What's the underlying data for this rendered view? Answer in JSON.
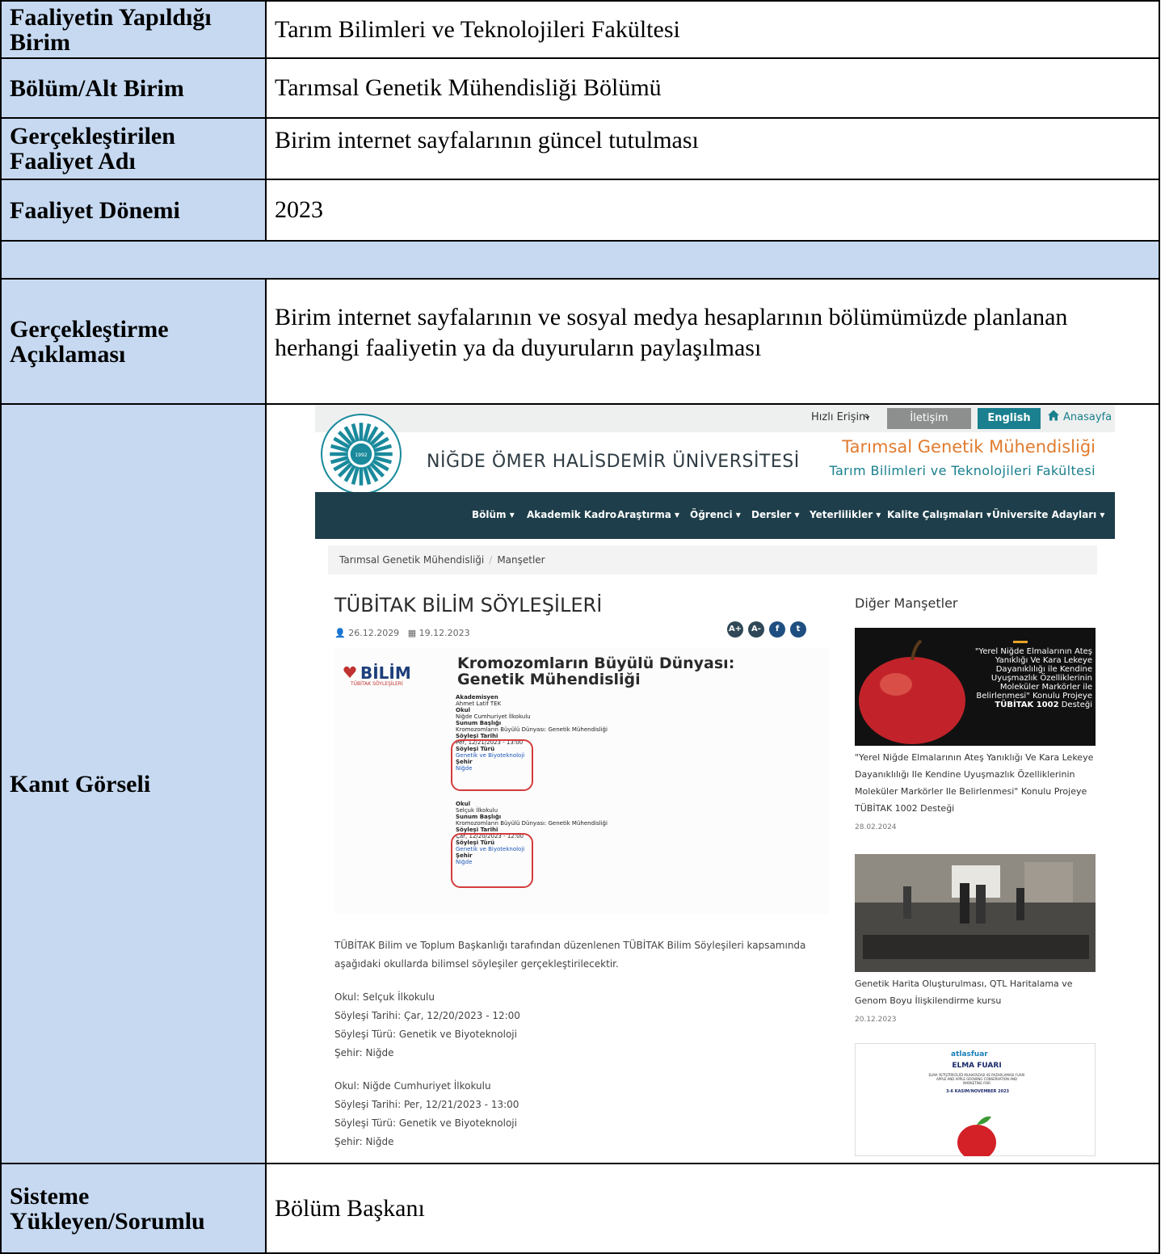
{
  "form": {
    "rows": [
      {
        "label": "Faaliyetin Yapıldığı Birim",
        "value": "Tarım Bilimleri ve Teknolojileri Fakültesi"
      },
      {
        "label": "Bölüm/Alt Birim",
        "value": "Tarımsal Genetik Mühendisliği Bölümü"
      },
      {
        "label": "Gerçekleştirilen Faaliyet Adı",
        "value": "Birim internet sayfalarının güncel tutulması"
      },
      {
        "label": "Faaliyet Dönemi",
        "value": "2023"
      }
    ],
    "description": {
      "label": "Gerçekleştirme Açıklaması",
      "value": "Birim internet sayfalarının ve sosyal medya hesaplarının bölümümüzde planlanan herhangi faaliyetin ya da duyuruların paylaşılması"
    },
    "evidence_label": "Kanıt Görseli",
    "uploader": {
      "label": "Sisteme Yükleyen/Sorumlu",
      "value": "Bölüm Başkanı"
    }
  },
  "site": {
    "topbar": {
      "quick_access": "Hızlı Erişim",
      "contact": "İletişim",
      "english": "English",
      "home": "Anasayfa"
    },
    "logo_year": "1992",
    "university": "NİĞDE ÖMER HALİSDEMİR ÜNİVERSİTESİ",
    "department": "Tarımsal Genetik Mühendisliği",
    "faculty": "Tarım Bilimleri ve Teknolojileri Fakültesi",
    "nav": [
      "Bölüm ▾",
      "Akademik Kadro",
      "Araştırma ▾",
      "Öğrenci ▾",
      "Dersler ▾",
      "Yeterlilikler ▾",
      "Kalite Çalışmaları ▾",
      "Üniversite Adayları ▾"
    ],
    "breadcrumb": [
      "Tarımsal Genetik Mühendisliği",
      "Manşetler"
    ],
    "news": {
      "title": "TÜBİTAK BİLİM SÖYLEŞİLERİ",
      "created": "26.12.2029",
      "date": "19.12.2023",
      "social": [
        "A+",
        "A-",
        "f",
        "t"
      ],
      "poster": {
        "logo_text": "BİLİM",
        "logo_sub": "TÜBİTAK SÖYLEŞİLERİ",
        "title_line1": "Kromozomların Büyülü Dünyası:",
        "title_line2": "Genetik Mühendisliği",
        "block1": [
          "Akademisyen",
          "Ahmet Latif TEK",
          "Okul",
          "Niğde Cumhuriyet İlkokulu",
          "Sunum Başlığı",
          "Kromozomların Büyülü Dünyası: Genetik Mühendisliği",
          "Söyleşi Tarihi",
          "Per, 12/21/2023 - 13:00",
          "Söyleşi Türü",
          "Genetik ve Biyoteknoloji",
          "Şehir",
          "Niğde"
        ],
        "block2": [
          "Okul",
          "Selçuk İlkokulu",
          "Sunum Başlığı",
          "Kromozomların Büyülü Dünyası: Genetik Mühendisliği",
          "Söyleşi Tarihi",
          "Çar, 12/20/2023 - 12:00",
          "Söyleşi Türü",
          "Genetik ve Biyoteknoloji",
          "Şehir",
          "Niğde"
        ]
      },
      "intro": "TÜBİTAK Bilim ve Toplum Başkanlığı tarafından düzenlenen TÜBİTAK Bilim Söyleşileri kapsamında aşağıdaki okullarda bilimsel söyleşiler gerçekleştirilecektir.",
      "school1": [
        "Okul: Selçuk İlkokulu",
        "Söyleşi Tarihi: Çar, 12/20/2023 - 12:00",
        "Söyleşi Türü: Genetik ve Biyoteknoloji",
        "Şehir: Niğde"
      ],
      "school2": [
        "Okul: Niğde Cumhuriyet İlkokulu",
        "Söyleşi Tarihi: Per, 12/21/2023 - 13:00",
        "Söyleşi Türü: Genetik ve Biyoteknoloji",
        "Şehir: Niğde"
      ]
    },
    "sidebar": {
      "heading": "Diğer Manşetler",
      "item1_overlay": [
        "\"Yerel Niğde Elmalarının Ateş",
        "Yanıklığı Ve Kara Lekeye",
        "Dayanıklılığı ile Kendine",
        "Uyuşmazlık Özelliklerinin",
        "Moleküler Markörler ile",
        "Belirlenmesi\" Konulu Projeye"
      ],
      "item1_overlay_bold": "TÜBİTAK 1002",
      "item1_overlay_end": " Desteği",
      "item1_caption": "\"Yerel Niğde Elmalarının Ateş Yanıklığı Ve Kara Lekeye Dayanıklılığı Ile Kendine Uyuşmazlık Özelliklerinin Moleküler Markörler Ile Belirlenmesi\" Konulu Projeye TÜBİTAK 1002 Desteği",
      "item1_date": "28.02.2024",
      "item2_caption": "Genetik Harita Oluşturulması, QTL Haritalama ve Genom Boyu İlişkilendirme kursu",
      "item2_date": "20.12.2023",
      "item3_brand": "atlasfuar",
      "item3_title": "ELMA FUARI",
      "item3_sub": "ELMA YETİŞTİRİCİLİĞİ MUHAFAZASI VE PAZARLAMASI FUARI APPLE AND APPLE GROWING CONSERVATION AND MARKETING FAIR",
      "item3_date": "3-6 KASIM/NOVEMBER 2023"
    }
  }
}
